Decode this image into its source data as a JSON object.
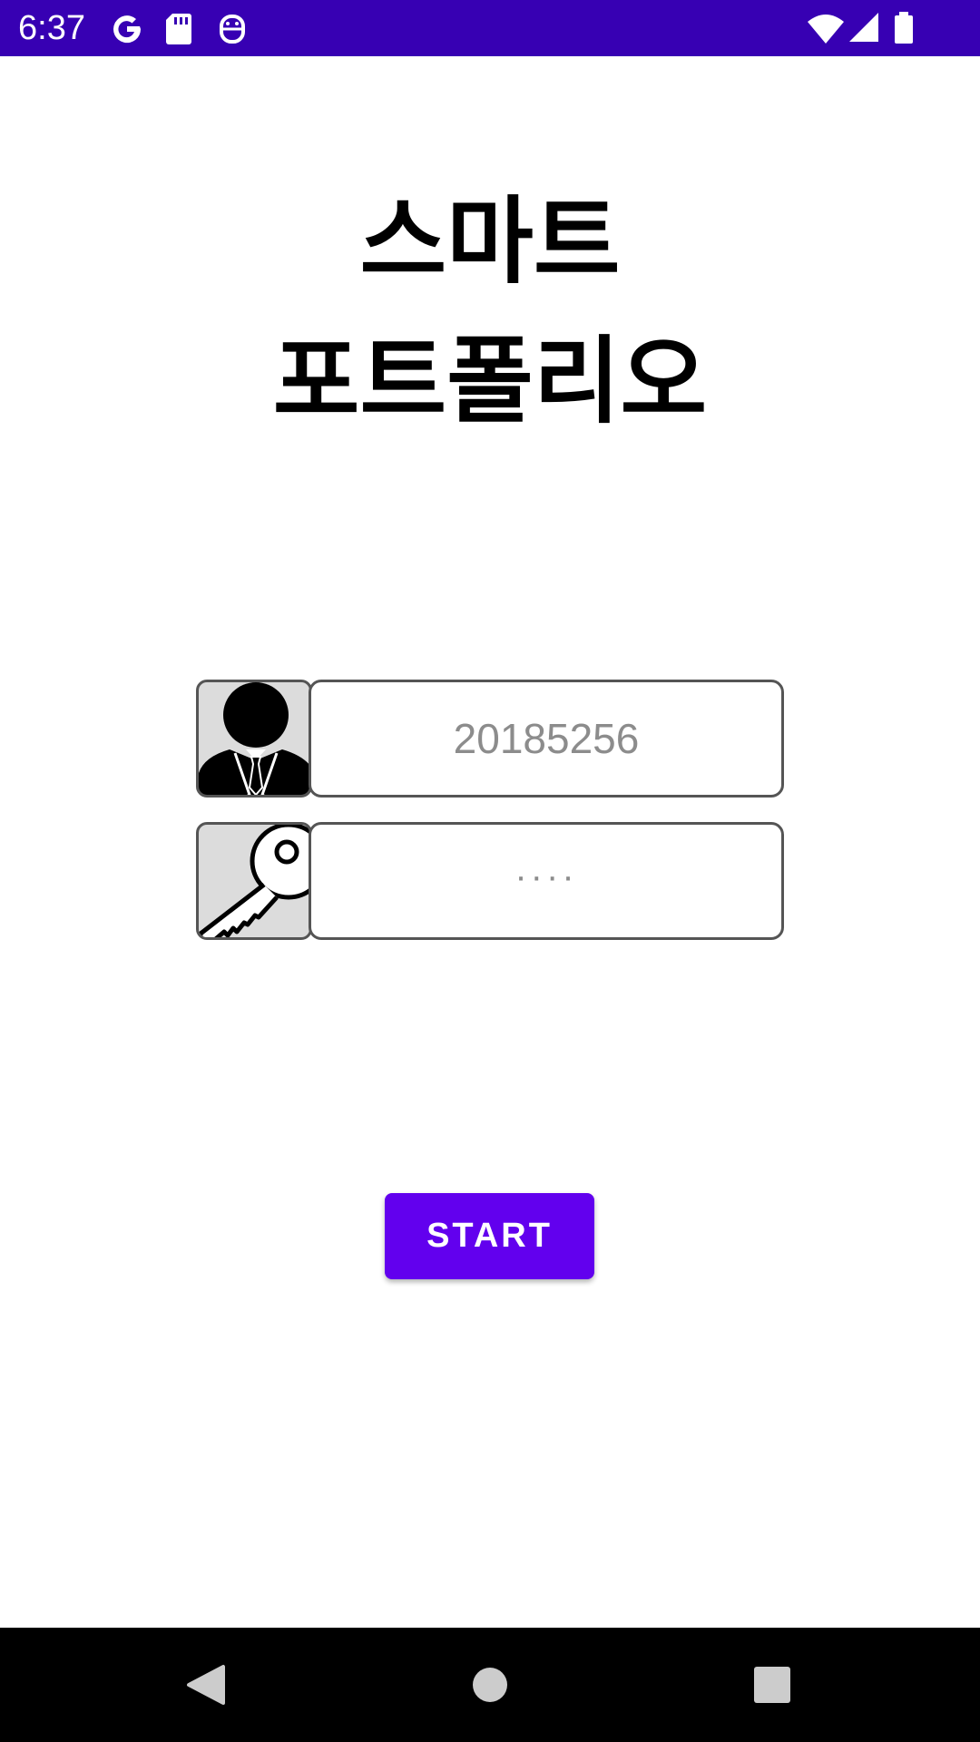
{
  "status_bar": {
    "time": "6:37",
    "left_icons": [
      "google-icon",
      "sd-card-icon",
      "robot-icon"
    ],
    "right_icons": [
      "wifi-icon",
      "signal-icon",
      "battery-icon"
    ],
    "background_color": "#3700B3"
  },
  "title": {
    "line1": "스마트",
    "line2": "포트폴리오"
  },
  "login": {
    "id_value": "20185256",
    "password_value": "····",
    "user_icon": "user-icon",
    "key_icon": "key-icon"
  },
  "start_button": {
    "label": "START",
    "color": "#6200EE"
  },
  "nav_bar": {
    "buttons": [
      "back-icon",
      "home-icon",
      "recents-icon"
    ]
  }
}
